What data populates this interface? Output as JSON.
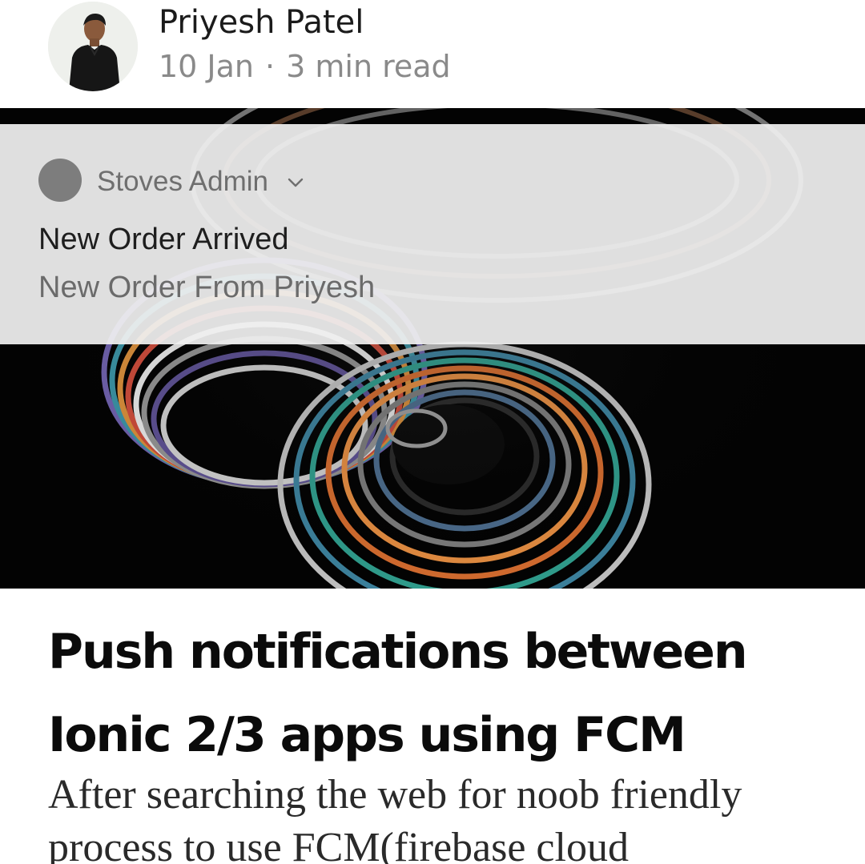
{
  "author": {
    "name": "Priyesh Patel",
    "date": "10 Jan",
    "separator": "·",
    "read_time": "3 min read"
  },
  "notification": {
    "app_icon": "circle-avatar-icon",
    "app_name": "Stoves Admin",
    "expand_icon": "chevron-down-icon",
    "title": "New Order Arrived",
    "body": "New Order From Priyesh",
    "background_color": "#f0f0f0"
  },
  "hero": {
    "description_icon": "abstract-swirl-image",
    "background_color": "#030303"
  },
  "article": {
    "title": "Push notifications between Ionic 2/3 apps using FCM",
    "subtitle": "After searching the web for noob friendly process to use FCM(firebase cloud"
  }
}
